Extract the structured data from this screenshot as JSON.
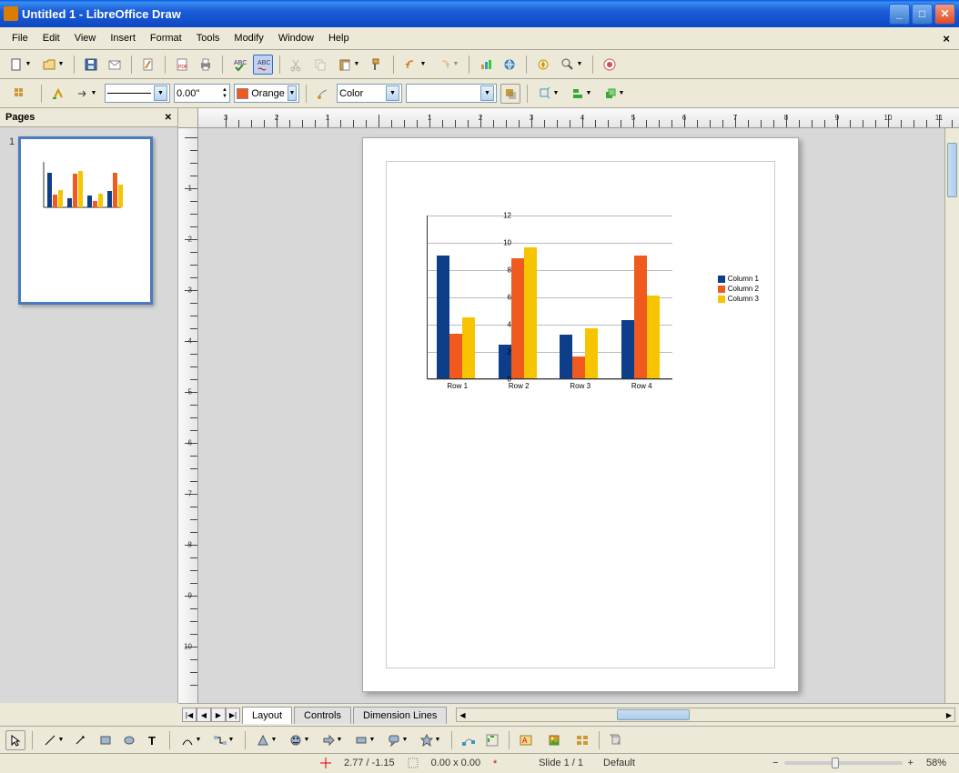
{
  "window": {
    "title": "Untitled 1 - LibreOffice Draw"
  },
  "menu": [
    "File",
    "Edit",
    "View",
    "Insert",
    "Format",
    "Tools",
    "Modify",
    "Window",
    "Help"
  ],
  "toolbar2": {
    "line_width": "0.00\"",
    "fill_color_label": "Orange",
    "fill_type": "Color"
  },
  "pages_panel": {
    "title": "Pages",
    "thumb_number": "1"
  },
  "tabs": {
    "layout": "Layout",
    "controls": "Controls",
    "dimension": "Dimension Lines"
  },
  "status": {
    "pos": "2.77 / -1.15",
    "size": "0.00 x 0.00",
    "slide": "Slide 1 / 1",
    "style": "Default",
    "zoom": "58%"
  },
  "ruler_h": [
    "3",
    "2",
    "1",
    "",
    "1",
    "2",
    "3",
    "4",
    "5",
    "6",
    "7",
    "8",
    "9",
    "10",
    "11"
  ],
  "ruler_v": [
    "",
    "1",
    "2",
    "3",
    "4",
    "5",
    "6",
    "7",
    "8",
    "9",
    "10"
  ],
  "chart_data": {
    "type": "bar",
    "categories": [
      "Row 1",
      "Row 2",
      "Row 3",
      "Row 4"
    ],
    "series": [
      {
        "name": "Column 1",
        "values": [
          9.0,
          2.5,
          3.2,
          4.3
        ],
        "color": "#0c3e8a"
      },
      {
        "name": "Column 2",
        "values": [
          3.3,
          8.8,
          1.6,
          9.0
        ],
        "color": "#f05a1e"
      },
      {
        "name": "Column 3",
        "values": [
          4.5,
          9.6,
          3.7,
          6.1
        ],
        "color": "#f7c400"
      }
    ],
    "ylim": [
      0,
      12
    ],
    "yticks": [
      0,
      2,
      4,
      6,
      8,
      10,
      12
    ]
  }
}
